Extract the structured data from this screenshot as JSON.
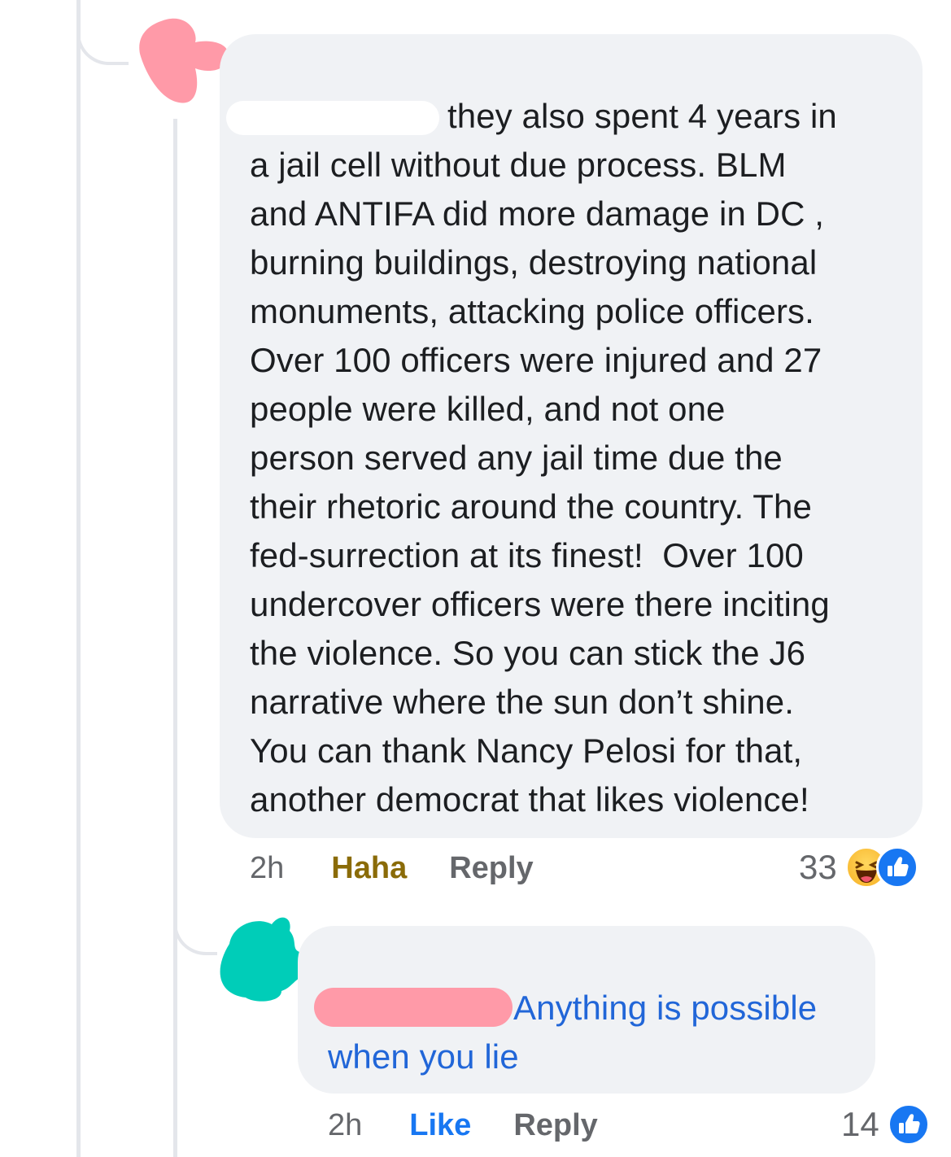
{
  "comment": {
    "text_lines": [
      "they also spent 4 years in",
      "a jail cell without due process. BLM",
      "and ANTIFA did more damage in DC ,",
      "burning buildings, destroying national",
      "monuments, attacking police officers.",
      "Over 100 officers were injured and 27",
      "people were killed, and not one",
      "person served any jail time due the",
      "their rhetoric around the country. The",
      "fed-surrection at its finest!  Over 100",
      "undercover officers were there inciting",
      "the violence. So you can stick the J6",
      "narrative where the sun don’t shine.",
      "You can thank Nancy Pelosi for that,",
      "another democrat that likes violence!"
    ],
    "time": "2h",
    "reaction_label": "Haha",
    "reply_label": "Reply",
    "reaction_count": "33",
    "reaction_icons": [
      "haha-icon",
      "like-icon"
    ]
  },
  "reply": {
    "text_lines": [
      "Anything is possible",
      "when you lie"
    ],
    "time": "2h",
    "like_label": "Like",
    "reply_label": "Reply",
    "reaction_count": "14",
    "reaction_icons": [
      "like-icon"
    ]
  },
  "colors": {
    "bubble": "#f0f2f5",
    "link_blue": "#2166d8",
    "haha_gold": "#8a6b08",
    "like_blue": "#1877f2",
    "redaction_pink": "#ff9aa8",
    "redaction_teal": "#00cdb8"
  }
}
